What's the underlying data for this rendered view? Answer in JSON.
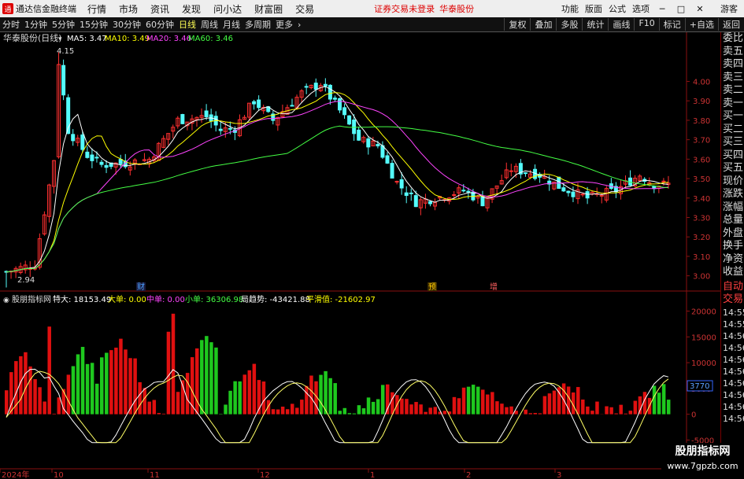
{
  "app": {
    "title": "通达信金融终端",
    "menus": [
      "行情",
      "市场",
      "资讯",
      "发现",
      "问小达",
      "财富圈",
      "交易"
    ],
    "notice": "证券交易未登录",
    "stock_name": "华泰股份",
    "right_menu": [
      "功能",
      "版面",
      "公式",
      "选项"
    ],
    "guest": "游客"
  },
  "tabs": {
    "periods": [
      "分时",
      "1分钟",
      "5分钟",
      "15分钟",
      "30分钟",
      "60分钟",
      "日线",
      "周线",
      "月线",
      "多周期",
      "更多"
    ],
    "active": "日线",
    "right": [
      "复权",
      "叠加",
      "多股",
      "统计",
      "画线",
      "F10",
      "标记",
      "+自选",
      "返回"
    ]
  },
  "main": {
    "title": "华泰股份(日线)",
    "ma": [
      {
        "label": "MA5: 3.47",
        "color": "#ffffff"
      },
      {
        "label": "MA10: 3.49",
        "color": "#ffff00"
      },
      {
        "label": "MA20: 3.46",
        "color": "#ff44ff"
      },
      {
        "label": "MA60: 3.46",
        "color": "#44ff44"
      }
    ],
    "high_label": "4.15",
    "low_label": "2.94",
    "yticks": [
      "4.00",
      "3.90",
      "3.80",
      "3.70",
      "3.60",
      "3.50",
      "3.40",
      "3.30",
      "3.20",
      "3.10",
      "3.00"
    ],
    "markers": [
      "财",
      "预",
      "增"
    ]
  },
  "sub": {
    "title": "股朋指标网",
    "items": [
      {
        "label": "特大: 18153.49",
        "color": "#ffffff"
      },
      {
        "label": "大单: 0.00",
        "color": "#ffff00"
      },
      {
        "label": "中单: 0.00",
        "color": "#ff44ff"
      },
      {
        "label": "小单: 36306.98",
        "color": "#44ff44"
      },
      {
        "label": "局趋势: -43421.88",
        "color": "#ffffff"
      },
      {
        "label": "平滑值: -21602.97",
        "color": "#ffff00"
      }
    ],
    "yticks": [
      "20000",
      "15000",
      "10000",
      "5000",
      "0",
      "-5000"
    ],
    "current": "3770"
  },
  "xaxis": [
    "2024年",
    "10",
    "11",
    "12",
    "1",
    "2",
    "3"
  ],
  "right_panel": {
    "labels": [
      "委比",
      "卖五",
      "卖四",
      "卖三",
      "卖二",
      "卖一",
      "买一",
      "买二",
      "买三",
      "买四",
      "买五",
      "现价",
      "涨跌",
      "涨幅",
      "总量",
      "外盘",
      "换手",
      "净资",
      "收益"
    ],
    "labels2": [
      "自动",
      "交易"
    ],
    "times": [
      "14:55",
      "14:55",
      "14:56",
      "14:56",
      "14:56",
      "14:56",
      "14:56",
      "14:56",
      "14:56",
      "14:56"
    ]
  },
  "watermark": {
    "line1": "股朋指标网",
    "line2": "www.7gpzb.com"
  },
  "chart_data": {
    "type": "candlestick",
    "main": {
      "close_high": 4.15,
      "close_low": 2.94,
      "ma_values": {
        "MA5": 3.47,
        "MA10": 3.49,
        "MA20": 3.46,
        "MA60": 3.46
      },
      "ylim": [
        2.95,
        4.18
      ]
    },
    "sub": {
      "type": "bar",
      "ylim": [
        -6000,
        21000
      ],
      "values": {
        "特大": 18153.49,
        "大单": 0,
        "中单": 0,
        "小单": 36306.98,
        "局趋势": -43421.88,
        "平滑值": -21602.97
      }
    }
  }
}
